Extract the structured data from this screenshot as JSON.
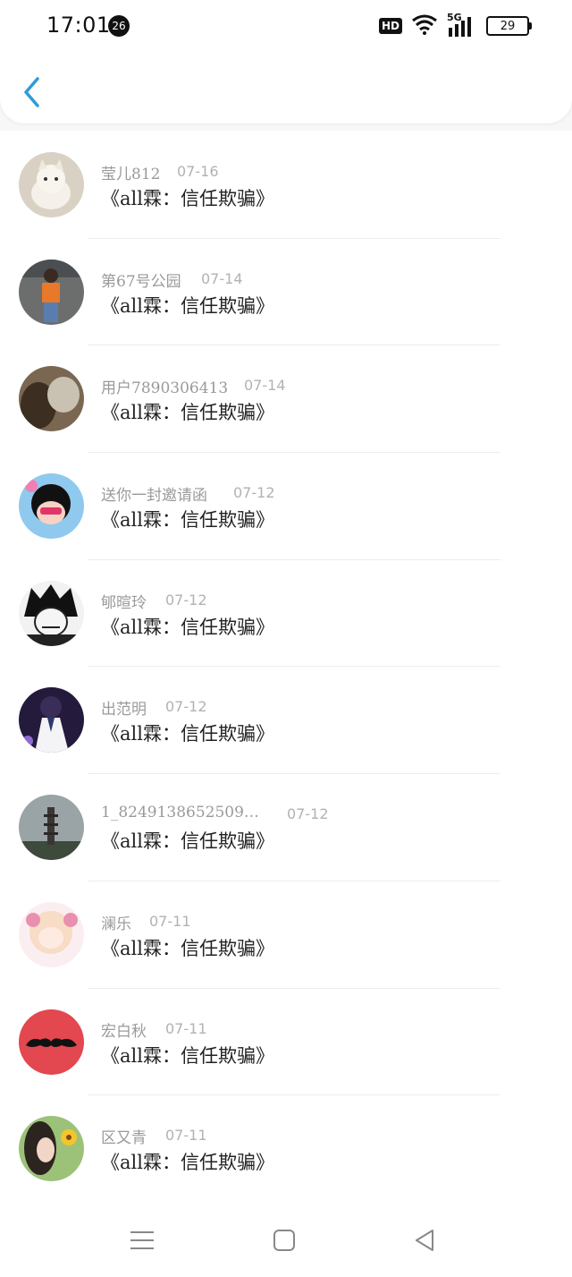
{
  "status_bar": {
    "time": "17:01",
    "notification_count": "26",
    "network": "5G",
    "hd_label": "HD",
    "battery": "29"
  },
  "header": {},
  "comments": [
    {
      "user": "莹儿812",
      "date": "07-16",
      "text": "《all霖：信任欺骗》",
      "avatar": "white-kitten"
    },
    {
      "user": "第67号公园",
      "date": "07-14",
      "text": "《all霖：信任欺骗》",
      "avatar": "person-orange-shirt"
    },
    {
      "user": "用户7890306413",
      "date": "07-14",
      "text": "《all霖：信任欺骗》",
      "avatar": "brown-blur-photo"
    },
    {
      "user": "送你一封邀请函",
      "date": "07-12",
      "text": "《all霖：信任欺骗》",
      "avatar": "anime-girl-pink"
    },
    {
      "user": "郇暄玲",
      "date": "07-12",
      "text": "《all霖：信任欺骗》",
      "avatar": "anime-boy-dark"
    },
    {
      "user": "出范明",
      "date": "07-12",
      "text": "《all霖：信任欺骗》",
      "avatar": "anime-boy-uniform"
    },
    {
      "user": "1_8249138652509…",
      "date": "07-12",
      "text": "《all霖：信任欺骗》",
      "avatar": "pagoda-tower"
    },
    {
      "user": "澜乐",
      "date": "07-11",
      "text": "《all霖：信任欺骗》",
      "avatar": "anime-girl-pastel"
    },
    {
      "user": "宏白秋",
      "date": "07-11",
      "text": "《all霖：信任欺骗》",
      "avatar": "mustache-red"
    },
    {
      "user": "区又青",
      "date": "07-11",
      "text": "《all霖：信任欺骗》",
      "avatar": "girl-sunflower"
    }
  ],
  "colors": {
    "accent": "#2f9bd8",
    "name_text": "#9a9a9a",
    "date_text": "#b2b2b2",
    "title_text": "#222222"
  }
}
